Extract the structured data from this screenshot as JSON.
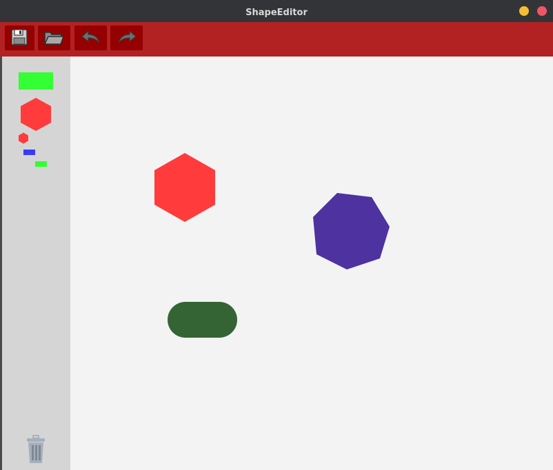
{
  "window": {
    "title": "ShapeEditor",
    "controls": [
      "minimize",
      "close"
    ]
  },
  "toolbar": {
    "buttons": [
      {
        "name": "save",
        "icon": "floppy-disk-icon"
      },
      {
        "name": "open",
        "icon": "folder-icon"
      },
      {
        "name": "undo",
        "icon": "undo-arrow-icon"
      },
      {
        "name": "redo",
        "icon": "redo-arrow-icon"
      }
    ],
    "color": "#b22222"
  },
  "palette": {
    "items": [
      {
        "shape": "rectangle",
        "color": "#33ff33"
      },
      {
        "shape": "hexagon",
        "color": "#ff3b3b"
      },
      {
        "shape": "hexagon",
        "color": "#ff3b3b"
      },
      {
        "shape": "rectangle",
        "color": "#3a3aff"
      },
      {
        "shape": "rectangle",
        "color": "#33ff33"
      }
    ],
    "trash_icon": "trash-can-icon"
  },
  "canvas": {
    "shapes": [
      {
        "shape": "hexagon",
        "color": "#ff3b3b"
      },
      {
        "shape": "heptagon",
        "color": "#4d32a0"
      },
      {
        "shape": "rounded-rectangle",
        "color": "#346434"
      }
    ]
  }
}
